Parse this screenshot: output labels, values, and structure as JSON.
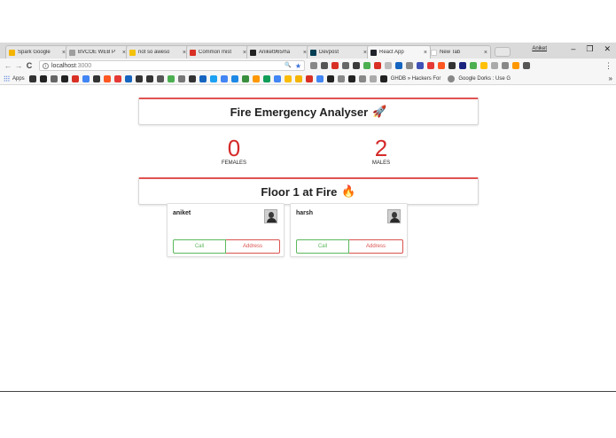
{
  "browser": {
    "tabs": [
      {
        "title": "Spark Google",
        "color": "#f4b400",
        "active": false
      },
      {
        "title": "BVCOE WEB P",
        "color": "#9e9e9e",
        "active": false
      },
      {
        "title": "not so aweso",
        "color": "#f4c20d",
        "active": false
      },
      {
        "title": "Common mist",
        "color": "#d93025",
        "active": false
      },
      {
        "title": "Aniket965/ha",
        "color": "#222222",
        "active": false
      },
      {
        "title": "Devpost",
        "color": "#003e54",
        "active": false
      },
      {
        "title": "React App",
        "color": "#20232a",
        "active": true
      },
      {
        "title": "New Tab",
        "color": "#ffffff",
        "active": false
      }
    ],
    "close_glyph": "×",
    "user_name": "Aniket",
    "window_buttons": {
      "minimize": "–",
      "restore": "❐",
      "close": "✕"
    },
    "url": "localhost",
    "url_port": ":3000",
    "nav": {
      "back": "←",
      "forward": "→",
      "reload": "C"
    },
    "omnibox_icons": [
      "🔍",
      "★"
    ],
    "menu_glyph": "⋮",
    "extension_colors": [
      "#888888",
      "#555555",
      "#d93025",
      "#666666",
      "#3a3a3a",
      "#4caf50",
      "#d93025",
      "#bbbbbb",
      "#1565c0",
      "#888888",
      "#3f51b5",
      "#e53935",
      "#ff5722",
      "#333333",
      "#1a237e",
      "#4caf50",
      "#ffc107",
      "#aaaaaa",
      "#888888",
      "#ff9800",
      "#555555"
    ],
    "bookmarks": {
      "apps_label": "Apps",
      "icon_colors": [
        "#333",
        "#222",
        "#666",
        "#222",
        "#d93025",
        "#4285f4",
        "#333",
        "#ff5722",
        "#e53935",
        "#1565c0",
        "#333",
        "#333",
        "#555",
        "#4caf50",
        "#777",
        "#333",
        "#1565c0",
        "#1da1f2",
        "#4285f4",
        "#1e88e5",
        "#388e3c",
        "#ff9800",
        "#0f9d58",
        "#4285f4",
        "#fbbc05",
        "#f4b400",
        "#d93025",
        "#4285f4",
        "#222",
        "#888",
        "#222",
        "#888",
        "#aaa"
      ],
      "text_items": [
        "GHDB » Hackers For",
        "Google Dorks : Use G"
      ],
      "overflow": "»"
    }
  },
  "app": {
    "title": "Fire Emergency Analyser",
    "title_emoji": "🚀",
    "stats": [
      {
        "value": "0",
        "label": "FEMALES"
      },
      {
        "value": "2",
        "label": "MALES"
      }
    ],
    "floor_banner": "Floor 1 at Fire",
    "floor_emoji": "🔥",
    "people": [
      {
        "name": "aniket",
        "call_label": "Call",
        "address_label": "Address"
      },
      {
        "name": "harsh",
        "call_label": "Call",
        "address_label": "Address"
      }
    ]
  }
}
